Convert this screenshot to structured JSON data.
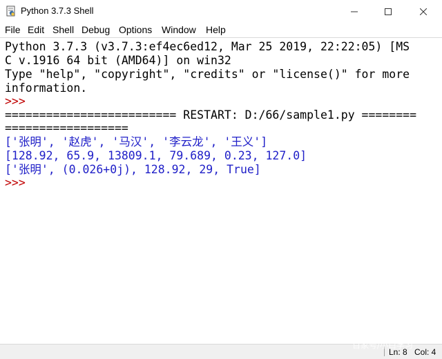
{
  "window": {
    "title": "Python 3.7.3 Shell",
    "icons": {
      "app": "python-idle-icon",
      "minimize": "minimize-icon",
      "maximize": "maximize-icon",
      "close": "close-icon"
    }
  },
  "menu": [
    "File",
    "Edit",
    "Shell",
    "Debug",
    "Options",
    "Window",
    "Help"
  ],
  "shell": {
    "lines": [
      "Python 3.7.3 (v3.7.3:ef4ec6ed12, Mar 25 2019, 22:22:05) [MS",
      "C v.1916 64 bit (AMD64)] on win32",
      "Type \"help\", \"copyright\", \"credits\" or \"license()\" for more",
      "information.",
      ">>>",
      "========================= RESTART: D:/66/sample1.py ========",
      "==================",
      "['张明', '赵虎', '马汉', '李云龙', '王义']",
      "[128.92, 65.9, 13809.1, 79.689, 0.23, 127.0]",
      "['张明', (0.026+0j), 128.92, 29, True]",
      ">>>"
    ]
  },
  "status": {
    "line": "Ln: 8",
    "col": "Col: 4"
  },
  "watermark": "百家号/小白学习",
  "colors": {
    "prompt": "#c00000",
    "output": "#2020c8",
    "text": "#000000",
    "status_bg": "#f0f0f0"
  }
}
